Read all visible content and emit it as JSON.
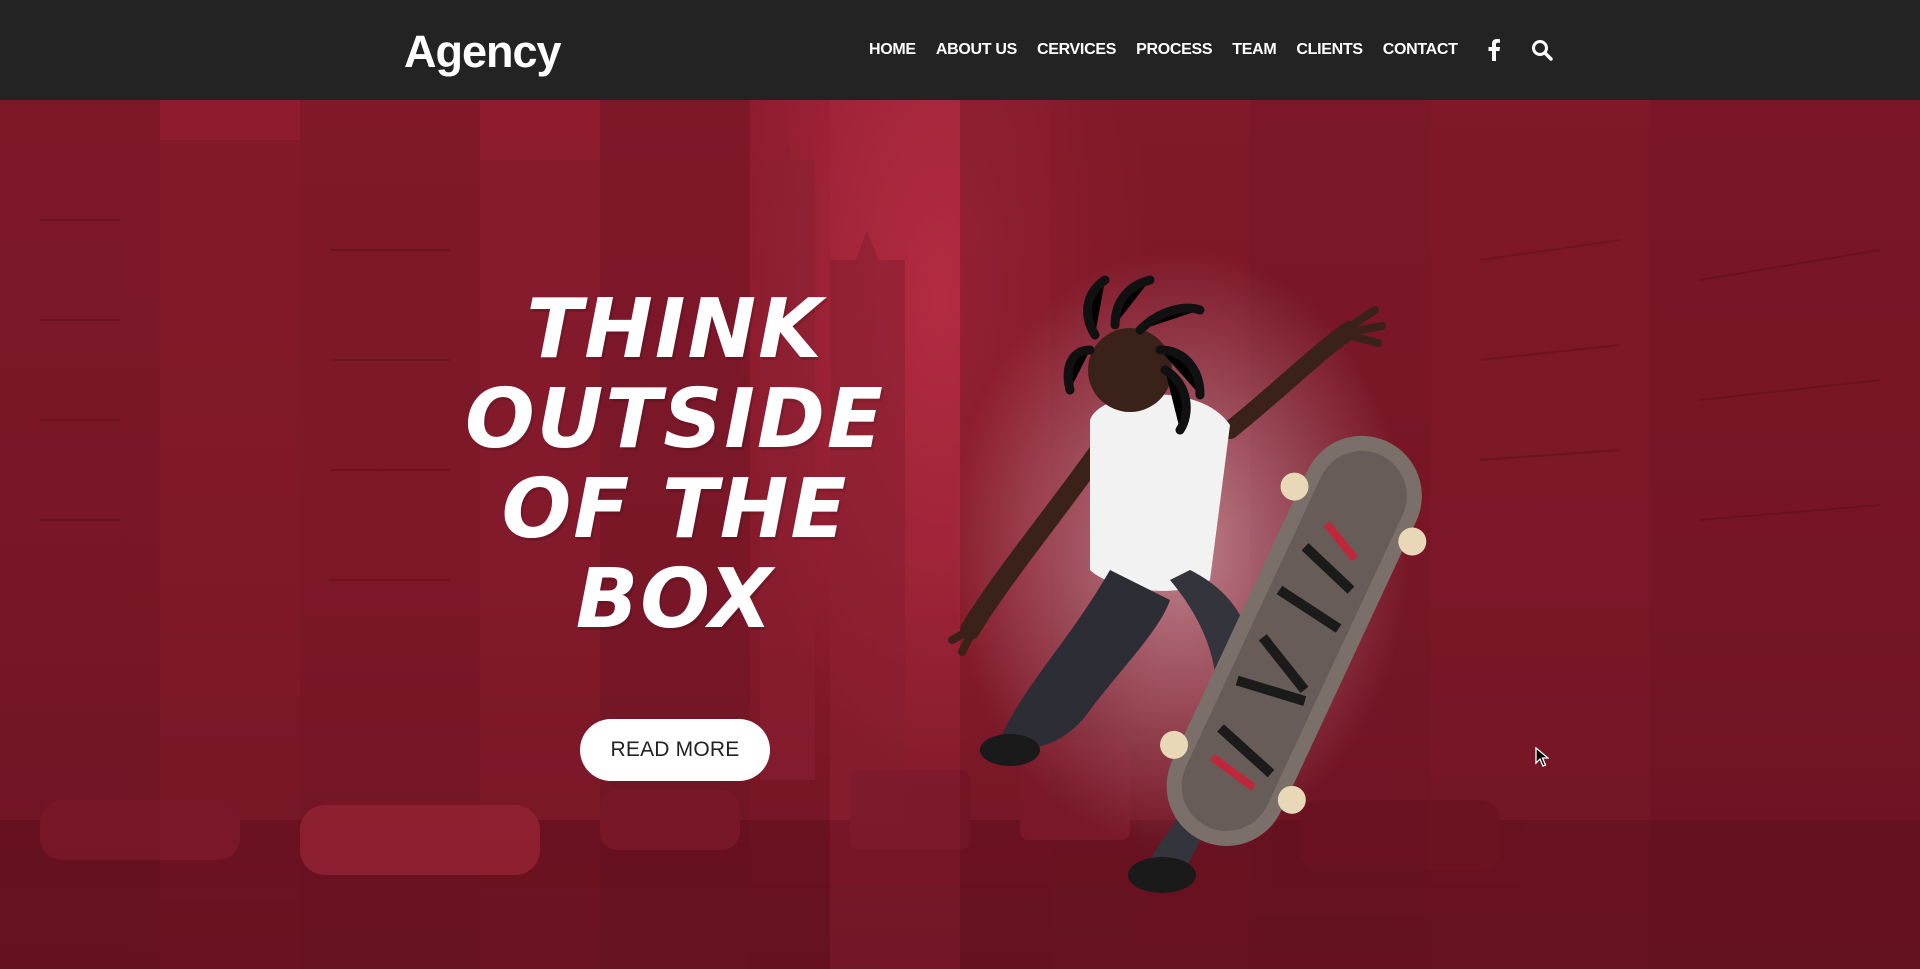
{
  "header": {
    "logo": "Agency",
    "nav": [
      "HOME",
      "ABOUT US",
      "CERVICES",
      "PROCESS",
      "TEAM",
      "CLIENTS",
      "CONTACT"
    ],
    "icons": [
      "facebook-icon",
      "search-icon"
    ]
  },
  "hero": {
    "headline": [
      "THINK",
      "OUTSIDE",
      "OF THE",
      "BOX"
    ],
    "button": "READ MORE"
  },
  "colors": {
    "header_bg": "#232323",
    "hero_tint": "#8e1c2e",
    "text": "#ffffff",
    "button_bg": "#ffffff"
  }
}
